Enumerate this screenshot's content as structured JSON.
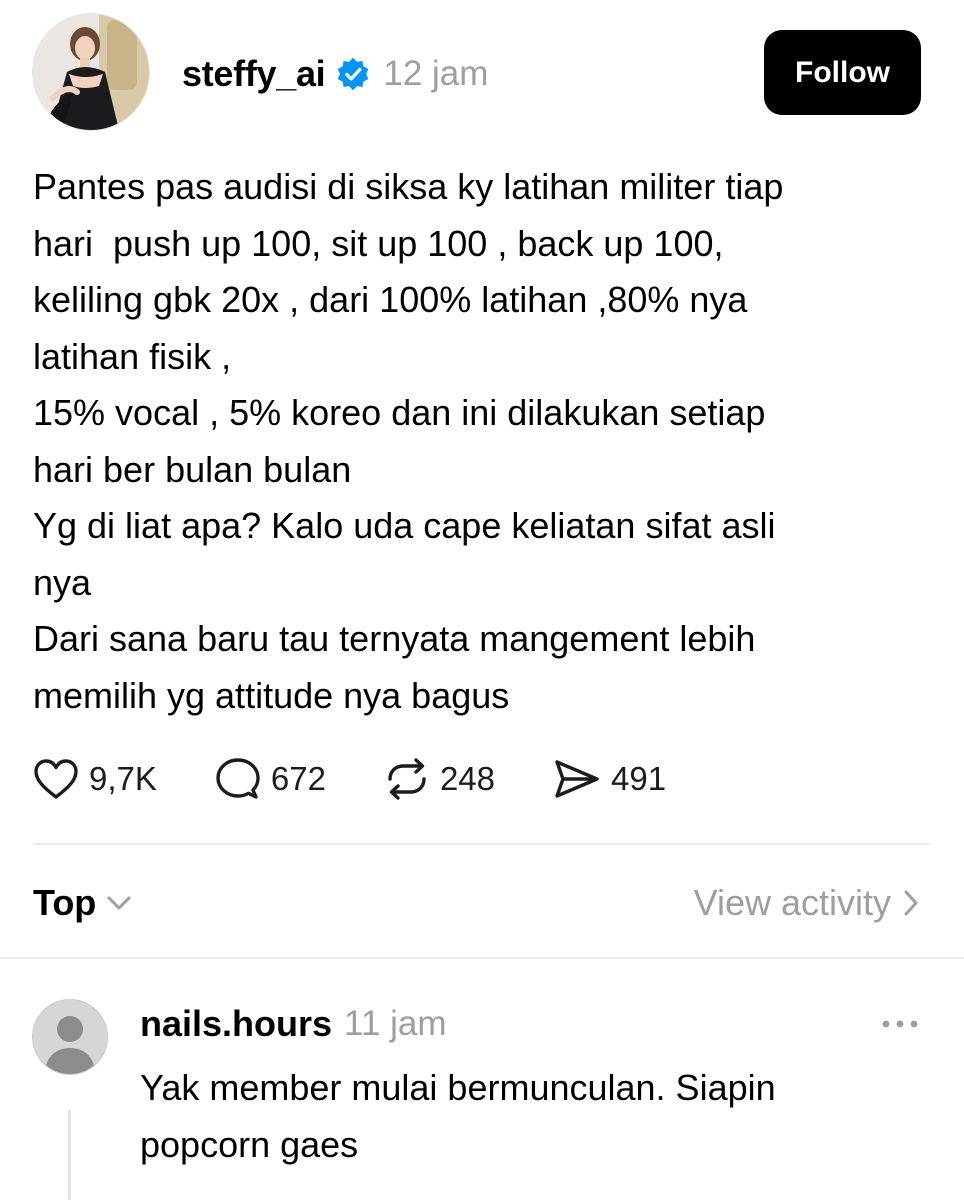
{
  "post": {
    "author": {
      "username": "steffy_ai",
      "timestamp": "12 jam",
      "verified": true
    },
    "follow_label": "Follow",
    "text_lines": [
      "Pantes pas audisi di siksa ky latihan militer tiap",
      "hari  push up 100, sit up 100 , back up 100,",
      "keliling gbk 20x , dari 100% latihan ,80% nya",
      "latihan fisik ,",
      "15% vocal , 5% koreo dan ini dilakukan setiap",
      "hari ber bulan bulan",
      "Yg di liat apa? Kalo uda cape keliatan sifat asli",
      "nya",
      "Dari sana baru tau ternyata mangement lebih",
      "memilih yg attitude nya bagus"
    ],
    "stats": {
      "likes": "9,7K",
      "replies": "672",
      "reposts": "248",
      "shares": "491"
    }
  },
  "sort": {
    "label": "Top",
    "activity_label": "View activity"
  },
  "reply": {
    "username": "nails.hours",
    "timestamp": "11 jam",
    "text_lines": [
      "Yak member mulai bermunculan. Siapin",
      "popcorn gaes"
    ]
  },
  "colors": {
    "text": "#000000",
    "muted": "#9e9e9e",
    "verified": "#0095f6",
    "button_bg": "#000000",
    "divider": "#ececec"
  },
  "icons": [
    "heart-icon",
    "comment-icon",
    "repost-icon",
    "share-icon",
    "chevron-down-icon",
    "chevron-right-icon",
    "more-icon",
    "verified-badge-icon"
  ]
}
